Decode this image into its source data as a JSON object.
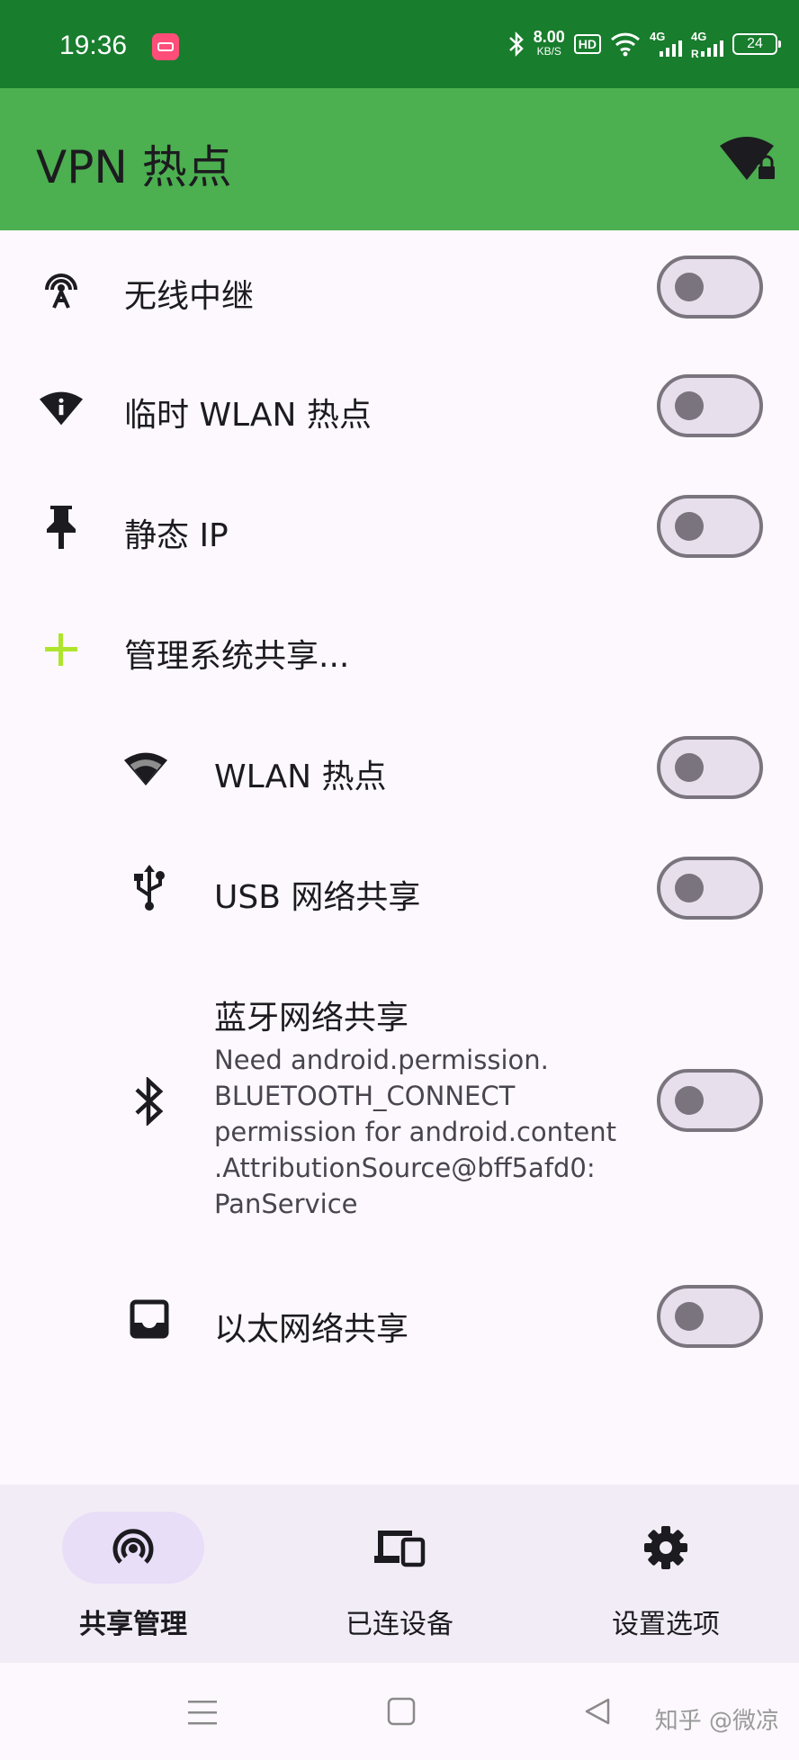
{
  "status_bar": {
    "time": "19:36",
    "net_speed_value": "8.00",
    "net_speed_unit": "KB/S",
    "hd_badge": "HD",
    "sim1_type": "4G",
    "sim2_type": "4G",
    "sim2_roaming": "R",
    "battery": "24"
  },
  "app_bar": {
    "title": "VPN 热点"
  },
  "tethering_list": [
    {
      "label": "无线中继",
      "icon": "wifi-tethering-icon",
      "enabled": false
    },
    {
      "label": "临时 WLAN 热点",
      "icon": "wifi-info-icon",
      "enabled": false
    },
    {
      "label": "静态 IP",
      "icon": "push-pin-icon",
      "enabled": false
    }
  ],
  "manage_system_sharing": {
    "label": "管理系统共享...",
    "icon": "add-icon",
    "accent": "#aee52c"
  },
  "system_tethering": [
    {
      "label": "WLAN 热点",
      "icon": "wifi-icon",
      "enabled": false
    },
    {
      "label": "USB 网络共享",
      "icon": "usb-icon",
      "enabled": false
    },
    {
      "label": "蓝牙网络共享",
      "icon": "bluetooth-icon",
      "enabled": false,
      "error_lines": [
        "Need android.permission.",
        "BLUETOOTH_CONNECT",
        "permission for android.content",
        ".AttributionSource@bff5afd0:",
        "PanService"
      ]
    },
    {
      "label": "以太网络共享",
      "icon": "ethernet-tray-icon",
      "enabled": false
    }
  ],
  "bottom_nav": {
    "items": [
      {
        "label": "共享管理",
        "icon": "hotspot-icon",
        "active": true
      },
      {
        "label": "已连设备",
        "icon": "devices-icon",
        "active": false
      },
      {
        "label": "设置选项",
        "icon": "gear-icon",
        "active": false
      }
    ]
  },
  "watermark": "知乎 @微凉",
  "colors": {
    "status_bar": "#187d2d",
    "app_bar": "#4caf50",
    "background": "#fcf8fd",
    "switch_track": "#e7e0ec",
    "switch_outline": "#79747e",
    "nav_background": "#f2ecf6",
    "nav_active_pill": "#e8def8"
  }
}
